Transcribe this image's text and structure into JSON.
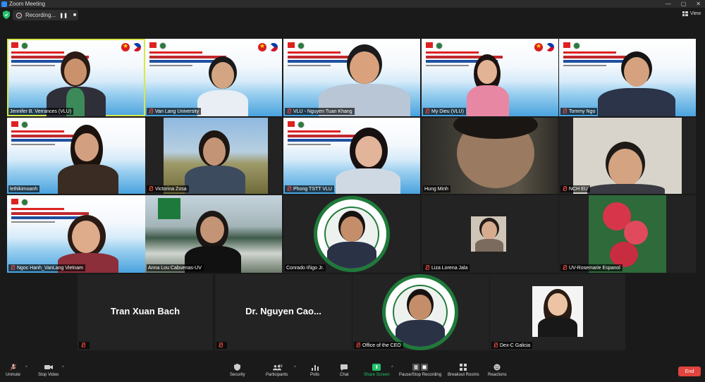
{
  "window": {
    "title": "Zoom Meeting",
    "controls": [
      "—",
      "▢",
      "✕"
    ]
  },
  "recording": {
    "label": "Recording...",
    "pause": "❚❚",
    "stop": "■"
  },
  "view_button": {
    "label": "View"
  },
  "tiles": [
    {
      "name": "Jennifer B. Verrances (VLU)"
    },
    {
      "name": "Van Lang University"
    },
    {
      "name": "VLU - Nguyen Tuan Khang"
    },
    {
      "name": "My Dieu (VLU)"
    },
    {
      "name": "Tommy Ngo"
    },
    {
      "name": "lethikimoanh"
    },
    {
      "name": "Victorina Zosa"
    },
    {
      "name": "Phong TSTT VLU"
    },
    {
      "name": "Hung Minh"
    },
    {
      "name": "NCH EU"
    },
    {
      "name": "Ngoc Hanh_VanLang Vietnam"
    },
    {
      "name": "Anna Lou  Cabuenas-UV"
    },
    {
      "name": "Conrado Iñigo Jr."
    },
    {
      "name": "Liza Lorena Jala"
    },
    {
      "name": "UV-Rosemarie Espanol"
    },
    {
      "name": "Tran Xuan Bach"
    },
    {
      "name": "Dr.  Nguyen Cao..."
    },
    {
      "name": "Office of the CEO"
    },
    {
      "name": "Dex-C Galicia"
    }
  ],
  "toolbar": {
    "unmute": "Unmute",
    "stop_video": "Stop Video",
    "security": "Security",
    "participants": "Participants",
    "participants_count": "19",
    "polls": "Polls",
    "chat": "Chat",
    "share_screen": "Share Screen",
    "pause_stop_recording": "Pause/Stop Recording",
    "breakout_rooms": "Breakout Rooms",
    "reactions": "Reactions",
    "end": "End"
  },
  "colors": {
    "end_button": "#e0443c",
    "share_green": "#23c36b",
    "active_speaker": "#d7e84a"
  }
}
